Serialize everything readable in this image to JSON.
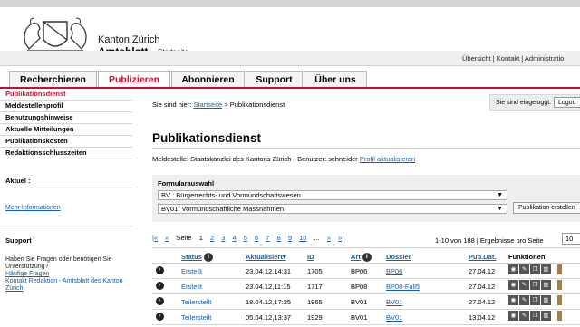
{
  "header": {
    "canton": "Kanton Zürich",
    "title": "Amtsblatt",
    "subtitle": "Startseite"
  },
  "util_links": "Übersicht | Kontakt | Administratio",
  "nav": [
    "Recherchieren",
    "Publizieren",
    "Abonnieren",
    "Support",
    "Über uns"
  ],
  "sidebar": {
    "items": [
      "Publikationsdienst",
      "Meldestellenprofil",
      "Benutzungshinweise",
      "Aktuelle Mitteilungen",
      "Publikationskosten",
      "Redaktionsschlusszeiten"
    ],
    "aktuell_title": "Aktuel :",
    "more_info": "Mehr Informationen",
    "support_title": "Support",
    "support_text": "Haben Sie Fragen oder benötigen Sie Unterstützung?",
    "faq_link": "Häufige Fragen",
    "contact_link": "Kontakt Redaktion - Amtsblatt des Kanton Zürich"
  },
  "breadcrumb": {
    "prefix": "Sie sind hier:",
    "home": "Startseite",
    "sep": ">",
    "current": "Publikationsdienst"
  },
  "login": {
    "text": "Sie sind eingeloggt.",
    "logout": "Logou"
  },
  "page_title": "Publikationsdienst",
  "meldestelle": {
    "text": "Meldestelle: Staatskanzlei des Kantons Zürich - Benutzer: schneider",
    "link": "Profil aktualisieren"
  },
  "form": {
    "label": "Formularauswahl",
    "select1": "BV : Bürgerrechts- und Vormundschaftswesen",
    "select2": "BV01: Vormundschaftliche Massnahmen",
    "button": "Publikation erstellen"
  },
  "pager": {
    "first": "|«",
    "prev": "«",
    "label": "Seite",
    "current": "1",
    "pages": [
      "2",
      "3",
      "4",
      "5",
      "6",
      "7",
      "8",
      "9",
      "10"
    ],
    "ellipsis": "...",
    "next": "»",
    "last": "»|",
    "count": "1-10 von 188 | Ergebnisse pro Seite",
    "per_page": "10"
  },
  "table": {
    "headers": {
      "status": "Status",
      "aktualisiert": "Aktualisiert",
      "sort_indicator": "▾",
      "id": "ID",
      "art": "Art",
      "dossier": "Dossier",
      "pubdat": "Pub.Dat.",
      "funktionen": "Funktionen"
    },
    "rows": [
      {
        "status": "Erstellt",
        "aktualisiert": "23.04.12,14:31",
        "id": "1705",
        "art": "BP06",
        "dossier": "BP06",
        "pubdat": "27.04.12"
      },
      {
        "status": "Erstellt",
        "aktualisiert": "23.04.12,11:15",
        "id": "1717",
        "art": "BP08",
        "dossier": "BP08-Fall5",
        "pubdat": "27.04.12"
      },
      {
        "status": "Teilerstellt",
        "aktualisiert": "18.04.12,17:25",
        "id": "1965",
        "art": "BV01",
        "dossier": "BV01",
        "pubdat": "27.04.12"
      },
      {
        "status": "Teilerstellt",
        "aktualisiert": "05.04.12,13:37",
        "id": "1929",
        "art": "BV01",
        "dossier": "BV01",
        "pubdat": "13.04.12"
      }
    ]
  },
  "icons": {
    "row_toggle": "chevron-right-icon",
    "info": "info-icon",
    "view": "eye-icon",
    "edit": "pencil-icon",
    "copy": "copy-icon",
    "delete": "trash-icon",
    "book": "book-icon"
  },
  "colors": {
    "accent": "#c8102e",
    "link": "#1a5ea8"
  }
}
